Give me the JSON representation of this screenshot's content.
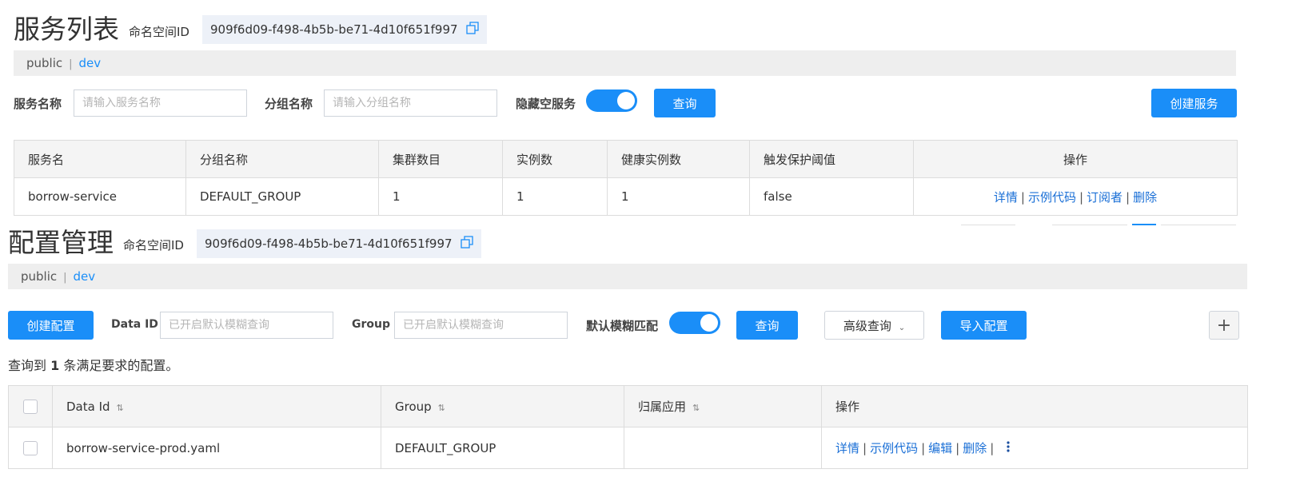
{
  "services": {
    "title": "服务列表",
    "ns_label": "命名空间ID",
    "ns_id": "909f6d09-f498-4b5b-be71-4d10f651f997",
    "crumbs": {
      "public": "public",
      "sep": "|",
      "dev": "dev"
    },
    "filters": {
      "service_name_label": "服务名称",
      "service_name_placeholder": "请输入服务名称",
      "group_name_label": "分组名称",
      "group_name_placeholder": "请输入分组名称",
      "hide_empty_label": "隐藏空服务",
      "hide_empty_on": true,
      "query_button": "查询",
      "create_button": "创建服务"
    },
    "table": {
      "headers": [
        "服务名",
        "分组名称",
        "集群数目",
        "实例数",
        "健康实例数",
        "触发保护阈值",
        "操作"
      ],
      "rows": [
        {
          "service": "borrow-service",
          "group": "DEFAULT_GROUP",
          "clusters": "1",
          "instances": "1",
          "healthy": "1",
          "threshold": "false"
        }
      ],
      "actions": [
        "详情",
        "示例代码",
        "订阅者",
        "删除"
      ]
    }
  },
  "configs": {
    "title": "配置管理",
    "ns_label": "命名空间ID",
    "ns_id": "909f6d09-f498-4b5b-be71-4d10f651f997",
    "crumbs": {
      "public": "public",
      "sep": "|",
      "dev": "dev"
    },
    "toolbar": {
      "create_button": "创建配置",
      "data_id_label": "Data ID",
      "data_id_placeholder": "已开启默认模糊查询",
      "group_label": "Group",
      "group_placeholder": "已开启默认模糊查询",
      "fuzzy_label": "默认模糊匹配",
      "fuzzy_on": true,
      "query_button": "查询",
      "advanced_button": "高级查询",
      "import_button": "导入配置",
      "plus_button": "+"
    },
    "result": {
      "prefix": "查询到",
      "count": "1",
      "suffix": "条满足要求的配置。"
    },
    "table": {
      "headers": [
        "Data Id",
        "Group",
        "归属应用",
        "操作"
      ],
      "rows": [
        {
          "data_id": "borrow-service-prod.yaml",
          "group": "DEFAULT_GROUP",
          "app": ""
        }
      ],
      "actions": [
        "详情",
        "示例代码",
        "编辑",
        "删除"
      ]
    }
  },
  "colors": {
    "primary": "#1a8ef8",
    "link": "#1a6fd6",
    "ns_bg": "#edf1f8",
    "crumb_bg": "#eeeeee"
  }
}
